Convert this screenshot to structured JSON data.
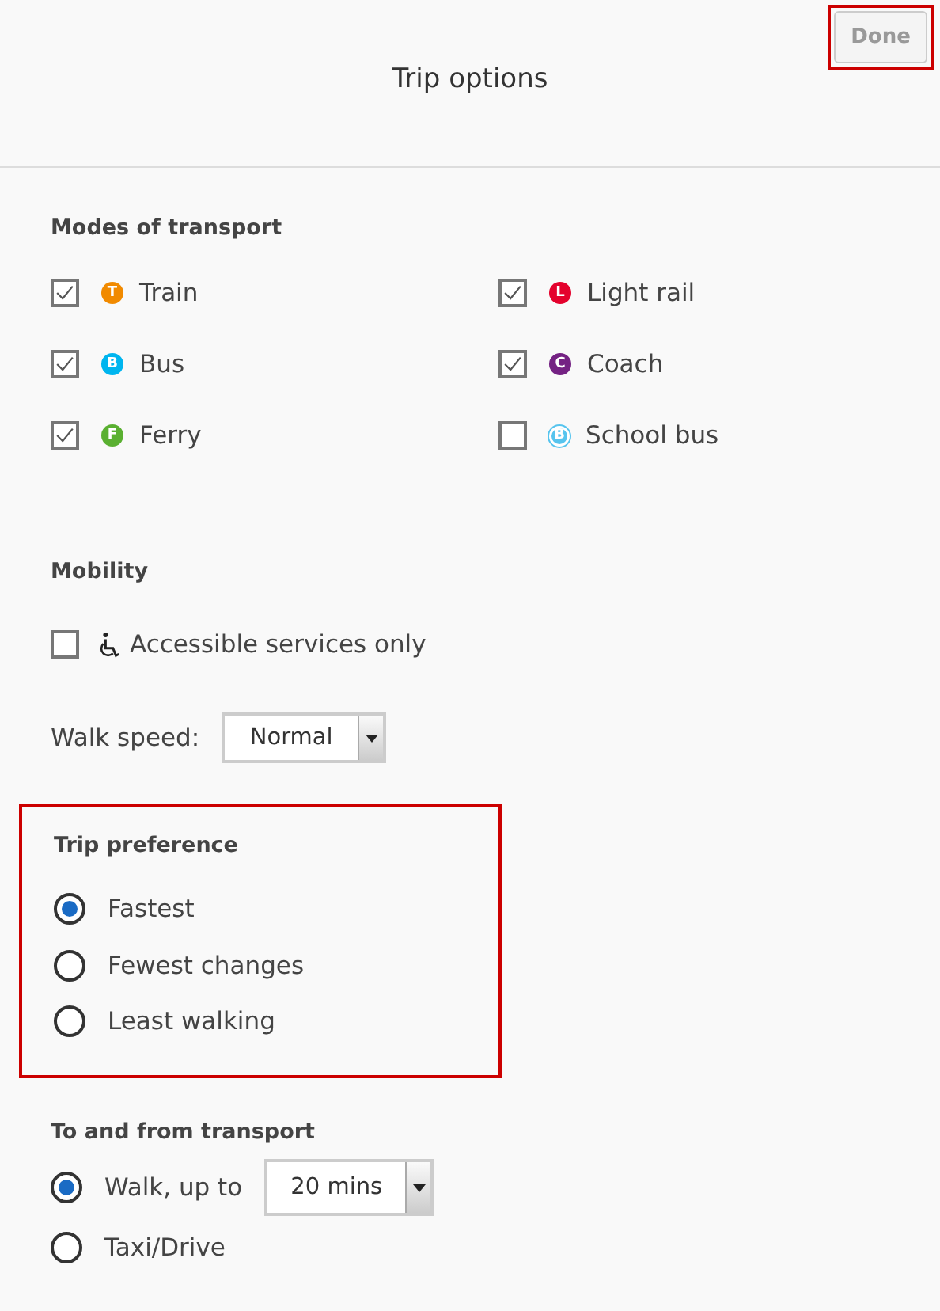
{
  "header": {
    "title": "Trip options",
    "done_button": {
      "label": "Done",
      "disabled": true,
      "highlighted": true
    }
  },
  "modes": {
    "heading": "Modes of transport",
    "items": [
      {
        "label": "Train",
        "badge": "T",
        "color": "#f18a00",
        "kind": "filled",
        "checked": true
      },
      {
        "label": "Light rail",
        "badge": "L",
        "color": "#e4022d",
        "kind": "filled",
        "checked": true
      },
      {
        "label": "Bus",
        "badge": "B",
        "color": "#00b5ef",
        "kind": "filled",
        "checked": true
      },
      {
        "label": "Coach",
        "badge": "C",
        "color": "#742283",
        "kind": "filled",
        "checked": true
      },
      {
        "label": "Ferry",
        "badge": "F",
        "color": "#5ab031",
        "kind": "filled",
        "checked": true
      },
      {
        "label": "School bus",
        "badge": "B",
        "color": "#56c4ee",
        "kind": "outline",
        "checked": false
      }
    ]
  },
  "mobility": {
    "heading": "Mobility",
    "accessible": {
      "label": "Accessible services only",
      "checked": false
    },
    "walk_speed": {
      "label": "Walk speed:",
      "value": "Normal"
    }
  },
  "trip_preference": {
    "heading": "Trip preference",
    "highlighted": true,
    "options": [
      {
        "label": "Fastest",
        "selected": true
      },
      {
        "label": "Fewest changes",
        "selected": false
      },
      {
        "label": "Least walking",
        "selected": false
      }
    ]
  },
  "to_from": {
    "heading": "To and from transport",
    "options": [
      {
        "kind": "select",
        "label": "Walk, up to",
        "value": "20 mins",
        "selected": true
      },
      {
        "kind": "plain",
        "label": "Taxi/Drive",
        "selected": false
      }
    ]
  }
}
